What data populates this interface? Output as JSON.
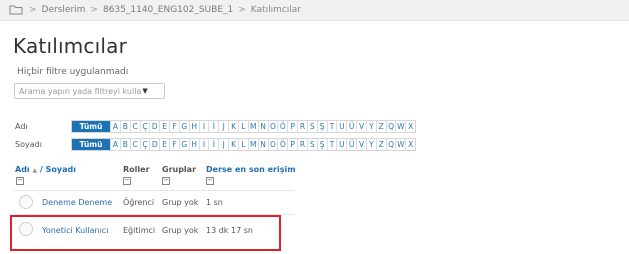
{
  "breadcrumb": {
    "icon": "folder-icon",
    "separator": ">",
    "items": [
      "Derslerim",
      "8635_1140_ENG102_SUBE_1",
      "Katılımcılar"
    ]
  },
  "page_title": "Katılımcılar",
  "filter_status": "Hiçbir filtre uygulanmadı",
  "filter_input": {
    "placeholder": "Arama yapın yada filtreyi kulla",
    "caret": "▼"
  },
  "letter_filters": {
    "all_label": "Tümü",
    "letters": [
      "A",
      "B",
      "C",
      "Ç",
      "D",
      "E",
      "F",
      "G",
      "H",
      "I",
      "İ",
      "J",
      "K",
      "L",
      "M",
      "N",
      "O",
      "Ö",
      "P",
      "R",
      "S",
      "Ş",
      "T",
      "U",
      "Ü",
      "V",
      "Y",
      "Z",
      "Q",
      "W",
      "X"
    ],
    "rows": [
      {
        "label": "Adı"
      },
      {
        "label": "Soyadı"
      }
    ]
  },
  "table": {
    "columns": {
      "name_first": "Adı",
      "sort_indicator": "▲",
      "name_last": "/ Soyadı",
      "roles": "Roller",
      "groups": "Gruplar",
      "last_access": "Derse en son erişim"
    },
    "rows": [
      {
        "name": "Deneme Deneme",
        "role": "Öğrenci",
        "group": "Grup yok",
        "last_access": "1 sn"
      },
      {
        "name": "Yonetici Kullanıcı",
        "role": "Eğitimci",
        "group": "Grup yok",
        "last_access": "13 dk 17 sn"
      }
    ]
  },
  "colors": {
    "link": "#1f6fb0",
    "all_button": "#1b73b3",
    "highlight": "#d9232e"
  }
}
